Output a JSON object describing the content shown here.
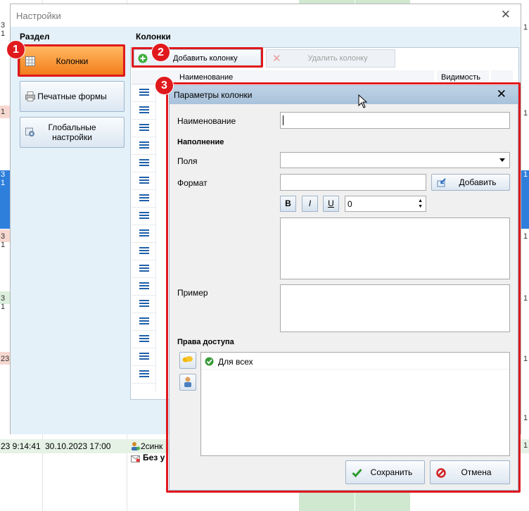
{
  "background": {
    "left_edge": [
      "3 1",
      "1",
      "3 1",
      "3 1",
      "3 1",
      "23"
    ],
    "right_edge": [
      "1",
      "1",
      "1",
      "1",
      "1",
      "1",
      "1",
      "1"
    ],
    "bottom_row": {
      "datetime1": "23 9:14:41",
      "datetime2": "30.10.2023 17:00",
      "cell1": "2синк",
      "cell2": "Без у",
      "right": "1"
    }
  },
  "settings": {
    "title": "Настройки",
    "close": "✕",
    "section_label": "Раздел",
    "columns_label": "Колонки",
    "sections": [
      {
        "label": "Колонки",
        "icon": "grid-icon",
        "active": true
      },
      {
        "label": "Печатные формы",
        "icon": "printer-icon",
        "active": false
      },
      {
        "label": "Глобальные настройки",
        "icon": "global-settings-icon",
        "active": false
      }
    ],
    "toolbar": {
      "add_label": "Добавить колонку",
      "delete_label": "Удалить колонку"
    },
    "grid_headers": {
      "name": "Наименование",
      "visibility": "Видимость"
    }
  },
  "badges": [
    "1",
    "2",
    "3"
  ],
  "dialog": {
    "title": "Параметры колонки",
    "close": "✕",
    "name_label": "Наименование",
    "name_value": "",
    "fill_label": "Наполнение",
    "fields_label": "Поля",
    "fields_value": "",
    "format_label": "Формат",
    "format_value": "",
    "add_button": "Добавить",
    "bold": "B",
    "italic": "I",
    "underline": "U",
    "size_value": "0",
    "example_label": "Пример",
    "access_label": "Права доступа",
    "access_items": [
      "Для всех"
    ],
    "save_button": "Сохранить",
    "cancel_button": "Отмена"
  },
  "colors": {
    "accent": "#e0191c",
    "active_section": "#f27b18",
    "title_bar": "#a8c2db",
    "panel_bg": "#e4f1f9"
  }
}
